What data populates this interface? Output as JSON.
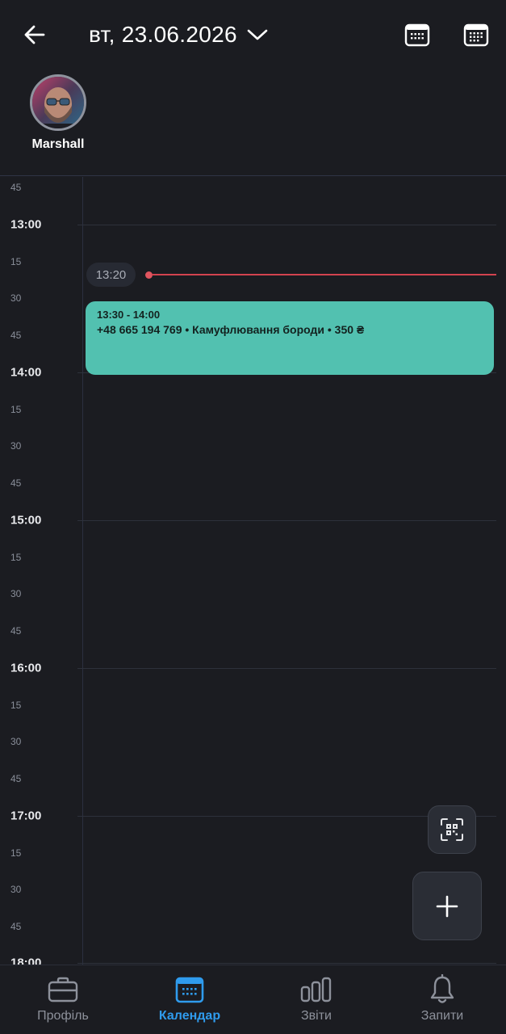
{
  "header": {
    "date": "вт, 23.06.2026",
    "icons": [
      "arrow-left-icon",
      "chevron-down-icon",
      "calendar-week-icon",
      "calendar-month-icon"
    ]
  },
  "staff": {
    "name": "Marshall"
  },
  "timeline": {
    "labels": [
      "45",
      "13:00",
      "15",
      "30",
      "45",
      "14:00",
      "15",
      "30",
      "45",
      "15:00",
      "15",
      "30",
      "45",
      "16:00",
      "15",
      "30",
      "45",
      "17:00",
      "15",
      "30",
      "45",
      "18:00"
    ],
    "hour_labels": [
      "13:00",
      "14:00",
      "15:00",
      "16:00",
      "17:00",
      "18:00"
    ],
    "current_time": "13:20"
  },
  "event": {
    "time": "13:30 - 14:00",
    "description": "+48 665 194 769 • Камуфлювання бороди • 350 ₴",
    "color": "#52c1b0"
  },
  "nav": {
    "items": [
      {
        "label": "Профіль",
        "icon": "briefcase-icon"
      },
      {
        "label": "Календар",
        "icon": "calendar-icon",
        "active": true
      },
      {
        "label": "Звіти",
        "icon": "bar-chart-icon"
      },
      {
        "label": "Запити",
        "icon": "bell-icon"
      }
    ]
  },
  "colors": {
    "accent": "#2f9bed",
    "now_line": "#d2434f",
    "background": "#1b1c21"
  }
}
